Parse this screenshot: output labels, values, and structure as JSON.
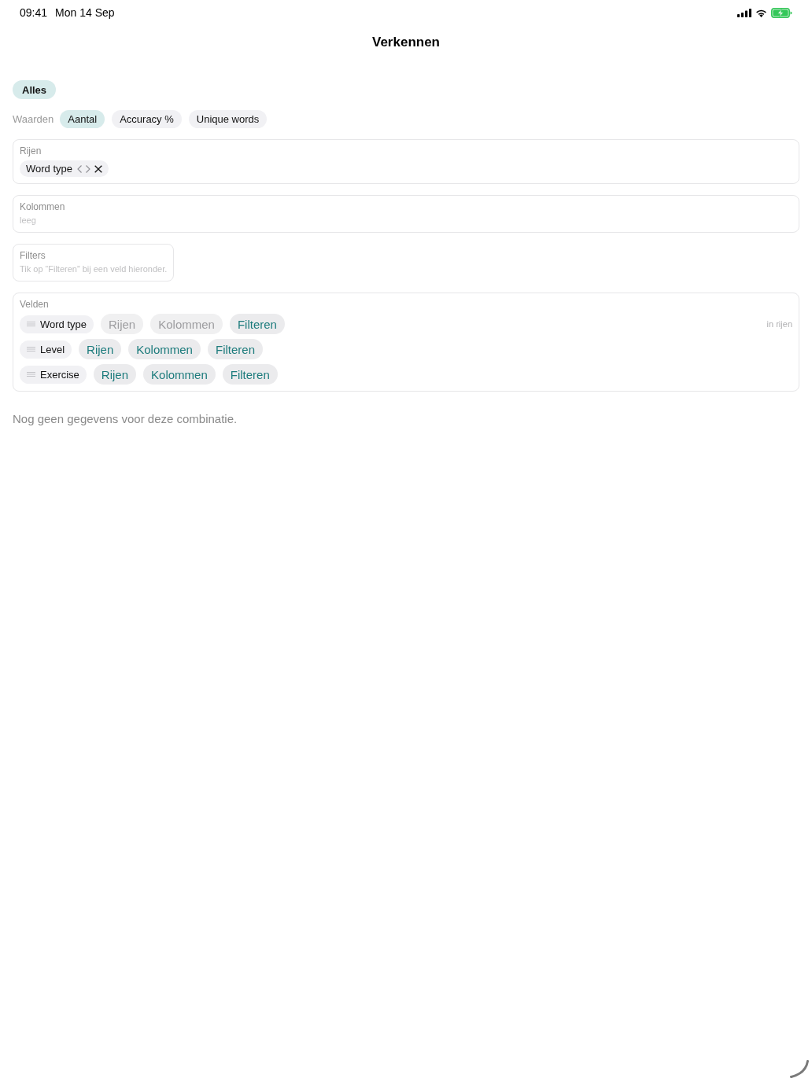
{
  "status_bar": {
    "time": "09:41",
    "date": "Mon 14 Sep"
  },
  "header": {
    "title": "Verkennen"
  },
  "scope_chips": [
    {
      "label": "Alles",
      "selected": true
    }
  ],
  "values": {
    "label": "Waarden",
    "options": [
      {
        "label": "Aantal",
        "selected": true
      },
      {
        "label": "Accuracy %",
        "selected": false
      },
      {
        "label": "Unique words",
        "selected": false
      }
    ]
  },
  "zones": [
    {
      "kind": "chips",
      "label": "Rijen",
      "items": [
        {
          "label": "Word type"
        }
      ]
    },
    {
      "kind": "empty",
      "label": "Kolommen",
      "text": "leeg"
    },
    {
      "kind": "hint",
      "label": "Filters",
      "text": "Tik op “Filteren” bij een veld hieronder."
    }
  ],
  "fields": {
    "label": "Velden",
    "items": [
      {
        "name": "Word type",
        "placement": "in rijen",
        "actions": [
          {
            "label": "Rijen",
            "disabled": true
          },
          {
            "label": "Kolommen",
            "disabled": true
          },
          {
            "label": "Filteren",
            "disabled": false
          }
        ]
      },
      {
        "name": "Level",
        "actions": [
          {
            "label": "Rijen",
            "disabled": false
          },
          {
            "label": "Kolommen",
            "disabled": false
          },
          {
            "label": "Filteren",
            "disabled": false
          }
        ]
      },
      {
        "name": "Exercise",
        "actions": [
          {
            "label": "Rijen",
            "disabled": false
          },
          {
            "label": "Kolommen",
            "disabled": false
          },
          {
            "label": "Filteren",
            "disabled": false
          }
        ]
      }
    ]
  },
  "empty_message": "Nog geen gegevens voor deze combinatie."
}
